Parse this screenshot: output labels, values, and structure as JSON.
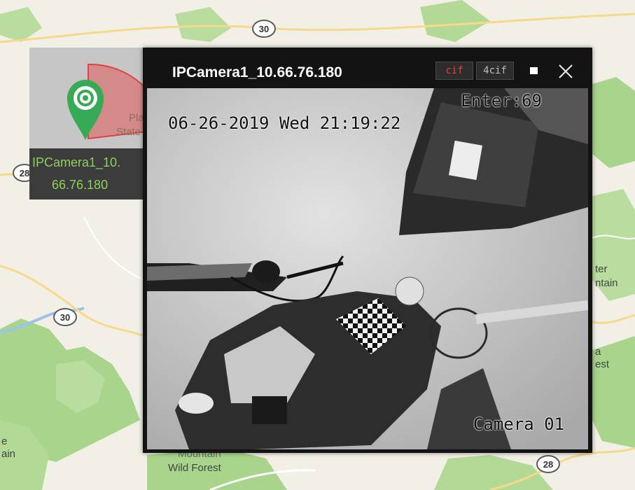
{
  "map": {
    "route_shields": [
      "30",
      "28",
      "30",
      "28"
    ],
    "labels": {
      "right_top": "ter",
      "right_mid": "ntain",
      "right_low1": "a",
      "right_low2": "est",
      "left_low1": "e",
      "left_low2": "ain",
      "bottom1": "Mountain",
      "bottom2": "Wild Forest",
      "marker_place1": "Pla",
      "marker_place2": "State"
    }
  },
  "camera_marker": {
    "label_line1": "IPCamera1_10.",
    "label_line2": "66.76.180",
    "colors": {
      "pin": "#2fa84f",
      "fov": "#e23a3a",
      "label_text": "#8fd05a"
    }
  },
  "camera_window": {
    "title": "IPCamera1_10.66.76.180",
    "buttons": {
      "cif": "cif",
      "four_cif": "4cif"
    },
    "video": {
      "enter_count": "Enter:69",
      "timestamp": "06-26-2019 Wed 21:19:22",
      "camera_name": "Camera 01"
    },
    "icons": {
      "minimize": "minimize-icon",
      "close": "close-icon"
    }
  }
}
